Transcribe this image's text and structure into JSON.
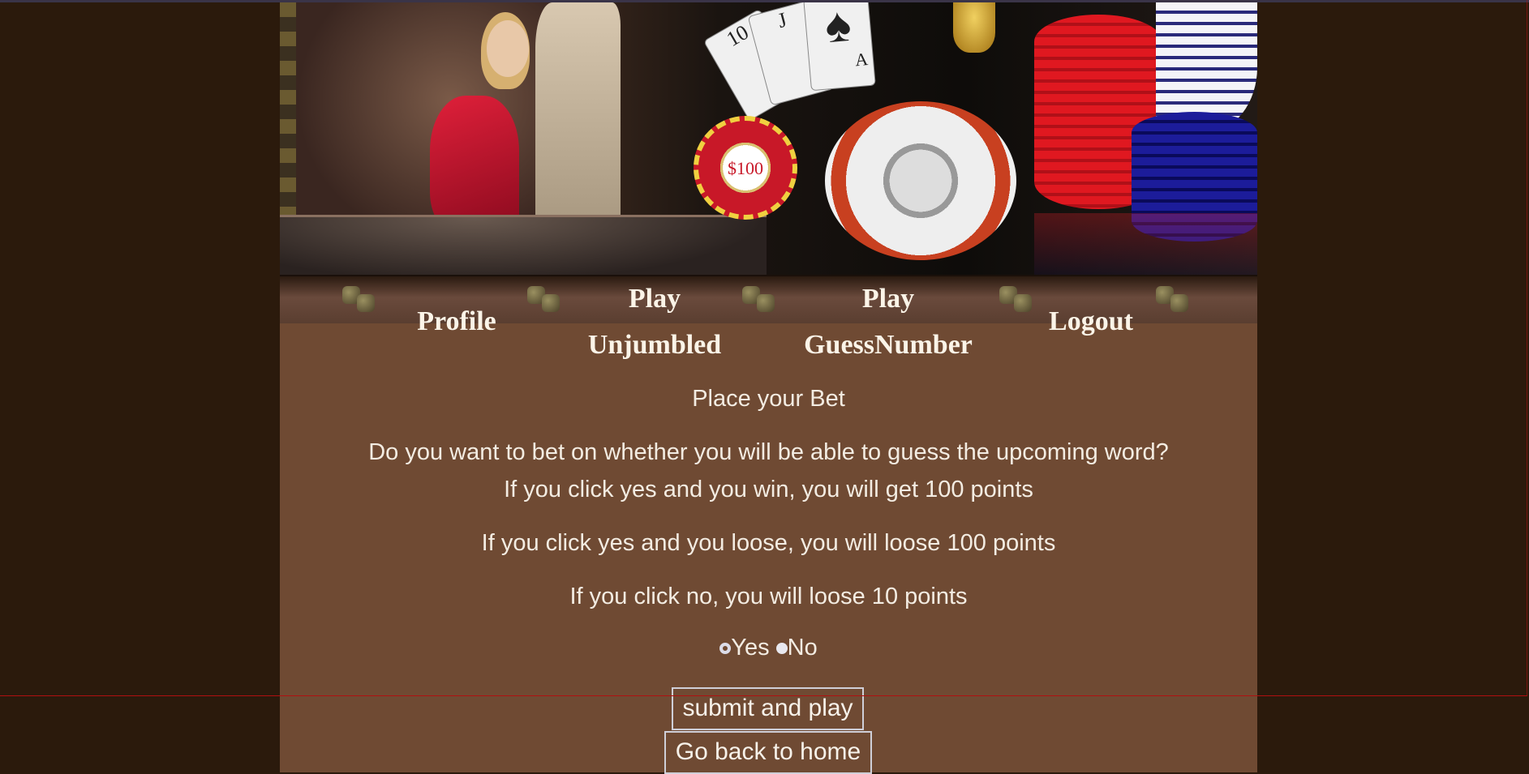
{
  "nav": {
    "items": [
      {
        "label": "Profile"
      },
      {
        "label_line1": "Play",
        "label_line2": "Unjumbled"
      },
      {
        "label_line1": "Play",
        "label_line2": "GuessNumber"
      },
      {
        "label": "Logout"
      }
    ]
  },
  "banner": {
    "chip_label": "$100",
    "card_ace": "A",
    "card_ten": "10",
    "card_jack": "J"
  },
  "content": {
    "heading": "Place your Bet",
    "question": "Do you want to bet on whether you will be able to guess the upcoming word?",
    "rule_win": "If you click yes and you win, you will get 100 points",
    "rule_lose": "If you click yes and you loose, you will loose 100 points",
    "rule_no": "If you click no, you will loose 10 points",
    "option_yes": "Yes",
    "option_no": "No",
    "selected_option": "Yes"
  },
  "buttons": {
    "submit_label": "submit and play",
    "home_label": "Go back to home"
  },
  "colors": {
    "page_bg": "#2b1a0c",
    "panel_bg": "#6f4a33",
    "text": "#f3ece2"
  }
}
